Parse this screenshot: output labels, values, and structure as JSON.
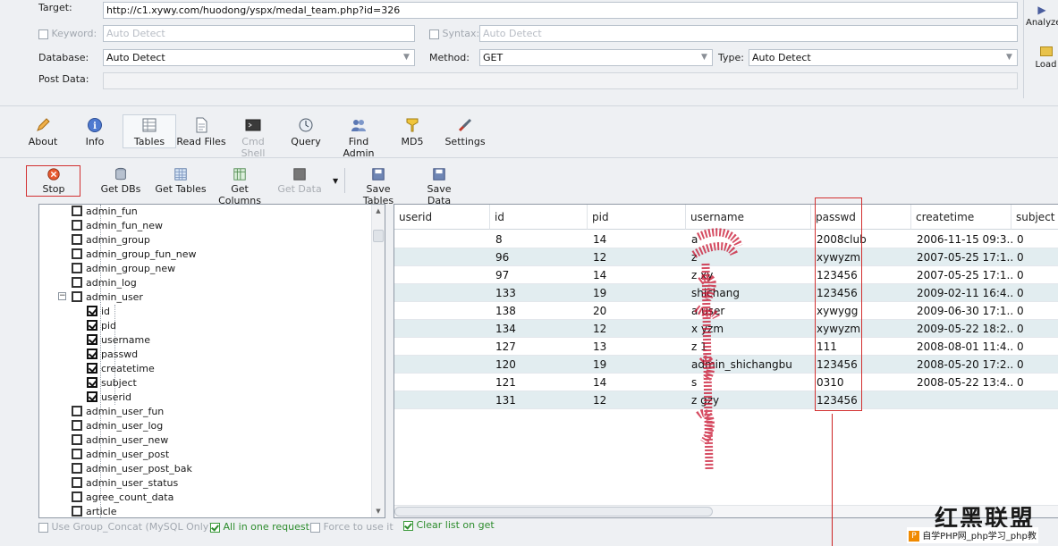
{
  "target": {
    "label": "Target:",
    "value": "http://c1.xywy.com/huodong/yspx/medal_team.php?id=326"
  },
  "keyword": {
    "label": "Keyword:",
    "value": "Auto Detect"
  },
  "syntax": {
    "label": "Syntax:",
    "value": "Auto Detect"
  },
  "database": {
    "label": "Database:",
    "value": "Auto Detect"
  },
  "method": {
    "label": "Method:",
    "value": "GET"
  },
  "type": {
    "label": "Type:",
    "value": "Auto Detect"
  },
  "post_data": {
    "label": "Post Data:",
    "value": ""
  },
  "side_buttons": {
    "analyze": "Analyze",
    "load": "Load"
  },
  "main_toolbar": [
    "About",
    "Info",
    "Tables",
    "Read Files",
    "Cmd Shell",
    "Query",
    "Find Admin",
    "MD5",
    "Settings"
  ],
  "sub_toolbar": [
    "Stop",
    "Get DBs",
    "Get Tables",
    "Get Columns",
    "Get Data",
    "Save Tables",
    "Save Data"
  ],
  "tree": [
    {
      "label": "admin_fun",
      "level": 1,
      "checked": false
    },
    {
      "label": "admin_fun_new",
      "level": 1,
      "checked": false
    },
    {
      "label": "admin_group",
      "level": 1,
      "checked": false
    },
    {
      "label": "admin_group_fun_new",
      "level": 1,
      "checked": false
    },
    {
      "label": "admin_group_new",
      "level": 1,
      "checked": false
    },
    {
      "label": "admin_log",
      "level": 1,
      "checked": false
    },
    {
      "label": "admin_user",
      "level": 1,
      "checked": false,
      "expanded": true
    },
    {
      "label": "id",
      "level": 2,
      "checked": true
    },
    {
      "label": "pid",
      "level": 2,
      "checked": true
    },
    {
      "label": "username",
      "level": 2,
      "checked": true
    },
    {
      "label": "passwd",
      "level": 2,
      "checked": true
    },
    {
      "label": "createtime",
      "level": 2,
      "checked": true
    },
    {
      "label": "subject",
      "level": 2,
      "checked": true
    },
    {
      "label": "userid",
      "level": 2,
      "checked": true
    },
    {
      "label": "admin_user_fun",
      "level": 1,
      "checked": false
    },
    {
      "label": "admin_user_log",
      "level": 1,
      "checked": false
    },
    {
      "label": "admin_user_new",
      "level": 1,
      "checked": false
    },
    {
      "label": "admin_user_post",
      "level": 1,
      "checked": false
    },
    {
      "label": "admin_user_post_bak",
      "level": 1,
      "checked": false
    },
    {
      "label": "admin_user_status",
      "level": 1,
      "checked": false
    },
    {
      "label": "agree_count_data",
      "level": 1,
      "checked": false
    },
    {
      "label": "article",
      "level": 1,
      "checked": false
    }
  ],
  "grid": {
    "columns": [
      "userid",
      "id",
      "pid",
      "username",
      "passwd",
      "createtime",
      "subject"
    ],
    "rows": [
      [
        "",
        "8",
        "14",
        "a",
        "2008club",
        "2006-11-15 09:3...",
        "0"
      ],
      [
        "",
        "96",
        "12",
        "z",
        "xywyzm",
        "2007-05-25 17:1...",
        "0"
      ],
      [
        "",
        "97",
        "14",
        "z xy",
        "123456",
        "2007-05-25 17:1...",
        "0"
      ],
      [
        "",
        "133",
        "19",
        "shichang",
        "123456",
        "2009-02-11 16:4...",
        "0"
      ],
      [
        "",
        "138",
        "20",
        "a user",
        "xywygg",
        "2009-06-30 17:1...",
        "0"
      ],
      [
        "",
        "134",
        "12",
        "x yzm",
        "xywyzm",
        "2009-05-22 18:2...",
        "0"
      ],
      [
        "",
        "127",
        "13",
        "z 1",
        "111",
        "2008-08-01 11:4...",
        "0"
      ],
      [
        "",
        "120",
        "19",
        "admin_shichangbu",
        "123456",
        "2008-05-20 17:2...",
        "0"
      ],
      [
        "",
        "121",
        "14",
        "s",
        "0310",
        "2008-05-22 13:4...",
        "0"
      ],
      [
        "",
        "131",
        "12",
        "z gzy",
        "123456",
        "",
        ""
      ]
    ]
  },
  "bottom_options": {
    "group_concat": "Use Group_Concat (MySQL Only)",
    "all_in_one": "All in one request.",
    "force": "Force to use it",
    "clear_list": "Clear list on get"
  },
  "watermark": {
    "text": "红黑联盟",
    "sub": "自学PHP网_php学习_php教"
  },
  "colors": {
    "alt_row": "#e2edf0",
    "highlight": "#d23030",
    "scribble": "#c8102e"
  }
}
